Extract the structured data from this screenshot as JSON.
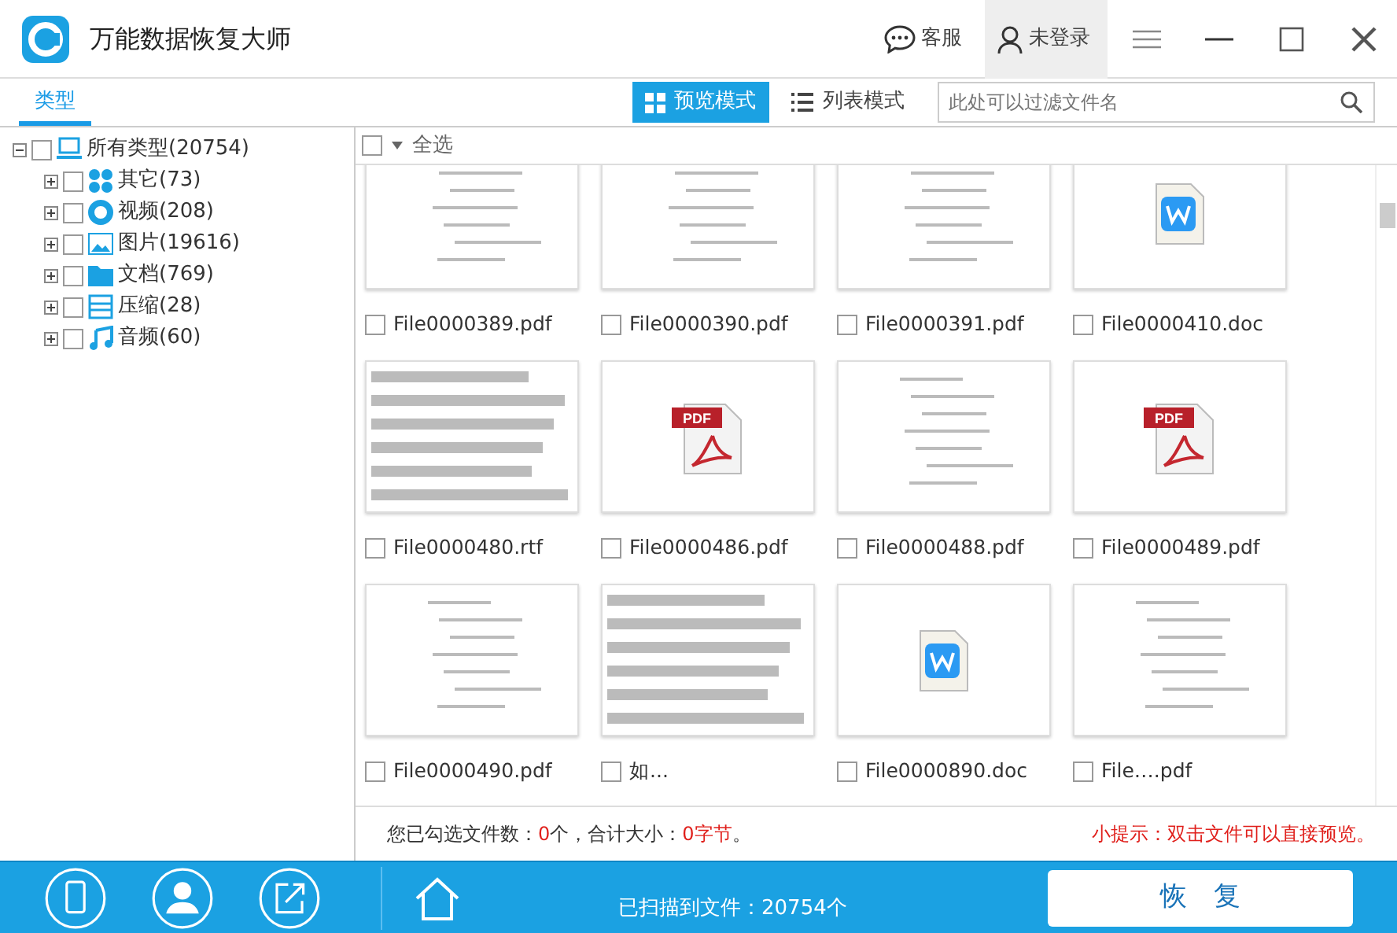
{
  "window": {
    "title": "万能数据恢复大师",
    "support": "客服",
    "login": "未登录"
  },
  "tabs": [
    {
      "label": "类型",
      "selected": true
    }
  ],
  "view_modes": [
    {
      "label": "预览模式",
      "kind": "grid",
      "selected": true
    },
    {
      "label": "列表模式",
      "kind": "list",
      "selected": false
    }
  ],
  "filter": {
    "placeholder": "此处可以过滤文件名"
  },
  "tree": [
    {
      "label": "所有类型(20754)",
      "kind": "computer",
      "checked": false,
      "expanded": true,
      "children": [
        {
          "label": "其它(73)",
          "kind": "other",
          "checked": false,
          "expanded": false
        },
        {
          "label": "视频(208)",
          "kind": "video",
          "checked": false,
          "expanded": false
        },
        {
          "label": "图片(19616)",
          "kind": "image",
          "checked": false,
          "expanded": false
        },
        {
          "label": "文档(769)",
          "kind": "folder",
          "checked": false,
          "expanded": false
        },
        {
          "label": "压缩(28)",
          "kind": "archive",
          "checked": false,
          "expanded": false
        },
        {
          "label": "音频(60)",
          "kind": "music",
          "checked": false,
          "expanded": false
        }
      ]
    }
  ],
  "select_all": {
    "label": "全选",
    "checked": false
  },
  "files": [
    {
      "name": "File0000389.pdf",
      "kind": "page",
      "checked": false
    },
    {
      "name": "File0000390.pdf",
      "kind": "page",
      "checked": false
    },
    {
      "name": "File0000391.pdf",
      "kind": "page",
      "checked": false
    },
    {
      "name": "File0000410.doc",
      "kind": "wps",
      "checked": false
    },
    {
      "name": "File0000480.rtf",
      "kind": "text",
      "checked": false
    },
    {
      "name": "File0000486.pdf",
      "kind": "pdf",
      "badge": "PDF",
      "checked": false
    },
    {
      "name": "File0000488.pdf",
      "kind": "page",
      "checked": false
    },
    {
      "name": "File0000489.pdf",
      "kind": "pdf",
      "badge": "PDF",
      "checked": false
    },
    {
      "name": "File0000490.pdf",
      "kind": "page",
      "checked": false
    },
    {
      "name": "如...",
      "kind": "text",
      "checked": false
    },
    {
      "name": "File0000890.doc",
      "kind": "wps",
      "checked": false
    },
    {
      "name": "File….pdf",
      "kind": "page",
      "checked": false
    }
  ],
  "status": {
    "label_count": "您已勾选文件数：",
    "count": "0",
    "label_size": "个，合计大小：",
    "size": "0字节",
    "end": "。",
    "hint": "小提示：双击文件可以直接预览。"
  },
  "footer": {
    "scanned": "已扫描到文件：20754个",
    "recover_button": "恢　复"
  }
}
